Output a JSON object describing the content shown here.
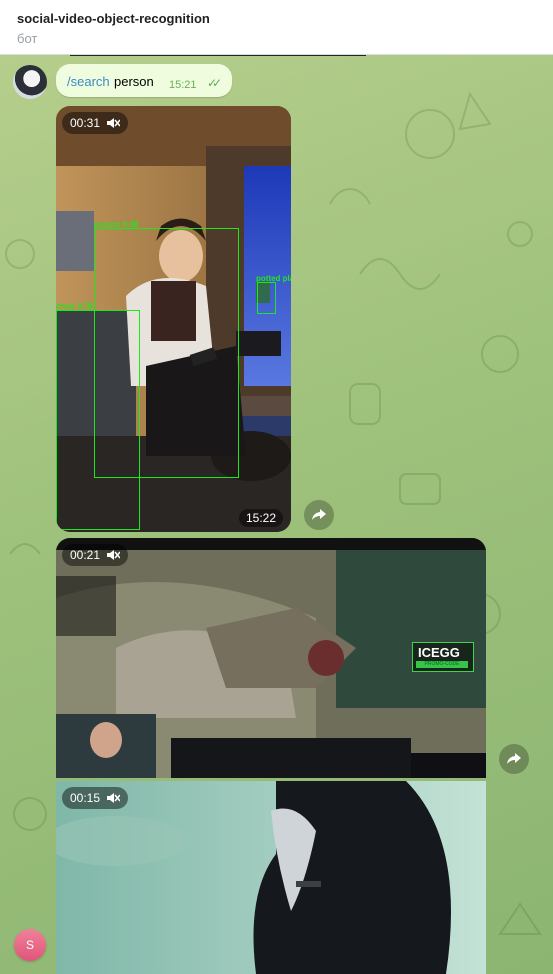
{
  "header": {
    "title": "social-video-object-recognition",
    "subtitle": "бот"
  },
  "message": {
    "command": "/search",
    "argument": "person",
    "time": "15:21"
  },
  "videos": [
    {
      "duration": "00:31",
      "time": "15:22",
      "detections": [
        "person 0.98",
        "potted plant",
        "chair 0.78"
      ]
    },
    {
      "duration": "00:21",
      "overlay_brand": "ICEGG",
      "overlay_sub": "PROMO-CODE"
    },
    {
      "duration": "00:15"
    }
  ],
  "user_avatar_letter": "S",
  "icons": [
    "mute-icon",
    "share-icon",
    "double-check-icon"
  ]
}
